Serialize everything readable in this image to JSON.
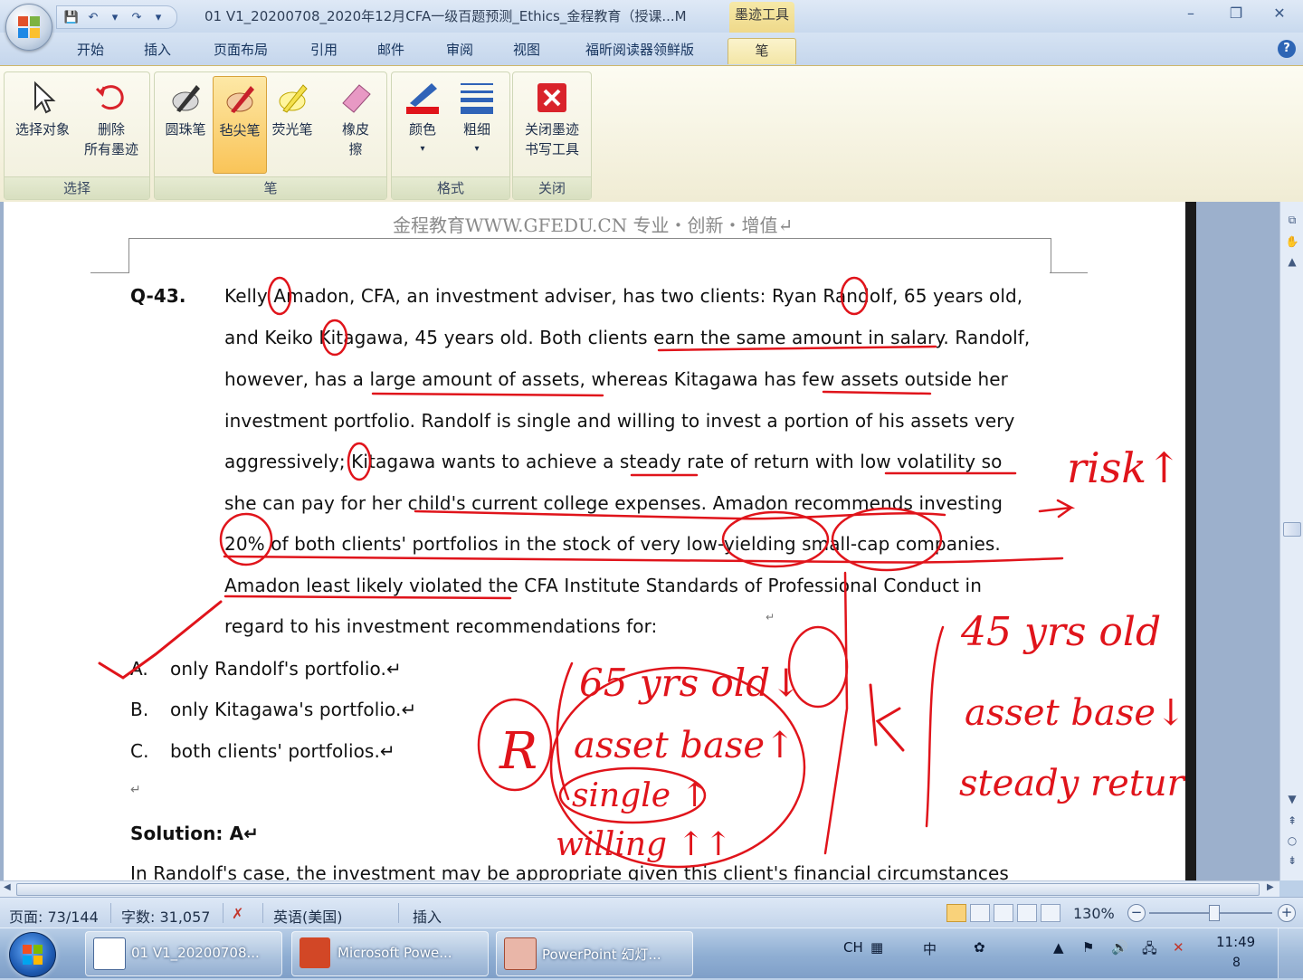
{
  "window": {
    "title": "01 V1_20200708_2020年12月CFA一级百题预测_Ethics_金程教育（授课...M",
    "context_tab": "墨迹工具",
    "minimize": "–",
    "restore": "❐",
    "close": "✕"
  },
  "quick_access": [
    "💾",
    "↶",
    "▾",
    "↷",
    "▾"
  ],
  "tabs": [
    "开始",
    "插入",
    "页面布局",
    "引用",
    "邮件",
    "审阅",
    "视图",
    "福昕阅读器领鲜版",
    "笔"
  ],
  "active_tab": "笔",
  "ribbon": {
    "groups": {
      "select": "选择",
      "pen": "笔",
      "format": "格式",
      "close": "关闭"
    },
    "buttons": {
      "select_objects": "选择对象",
      "delete_all_1": "删除",
      "delete_all_2": "所有墨迹",
      "ballpoint": "圆珠笔",
      "felt_tip": "毡尖笔",
      "highlighter": "荧光笔",
      "eraser_1": "橡皮",
      "eraser_2": "擦",
      "color": "颜色",
      "weight": "粗细",
      "close_ink_1": "关闭墨迹",
      "close_ink_2": "书写工具"
    }
  },
  "document": {
    "header": "金程教育WWW.GFEDU.CN 专业・创新・增值↵",
    "question_id": "Q-43.",
    "lines": [
      "Kelly Amadon, CFA, an investment adviser, has two clients: Ryan Randolf, 65 years old,",
      "and Keiko Kitagawa, 45 years old. Both clients earn the same amount in salary. Randolf,",
      "however, has a large amount of assets, whereas Kitagawa has few assets outside her",
      "investment portfolio. Randolf is single and willing to invest a portion of his assets very",
      "aggressively; Kitagawa wants to achieve a steady rate of return with low volatility so",
      "she can pay for her child's current college expenses. Amadon recommends investing",
      "20% of both clients' portfolios in the stock of very low-yielding small-cap companies.",
      "Amadon least likely violated the CFA Institute Standards of Professional Conduct in",
      "regard to his investment recommendations for:"
    ],
    "paragraph_mark": "↵",
    "options": [
      {
        "letter": "A.",
        "text": "only Randolf's portfolio.↵"
      },
      {
        "letter": "B.",
        "text": "only Kitagawa's portfolio.↵"
      },
      {
        "letter": "C.",
        "text": "both clients' portfolios.↵"
      }
    ],
    "empty_line": "↵",
    "solution": "Solution: A↵",
    "partial_line": "In Randolf's case, the investment may be appropriate given this client's financial circumstances"
  },
  "handwriting": {
    "risk": "risk↑",
    "r_label": "R",
    "r_lines": [
      "65 yrs old↓",
      "asset base↑",
      "single ↑",
      "willing ↑↑"
    ],
    "k_label": "K",
    "k_lines": [
      "45 yrs old",
      "asset base↓",
      "steady return"
    ]
  },
  "status": {
    "page": "页面: 73/144",
    "words": "字数: 31,057",
    "language": "英语(美国)",
    "mode": "插入",
    "zoom": "130%",
    "zoom_minus": "−",
    "zoom_plus": "+"
  },
  "taskbar": {
    "items": [
      "01 V1_20200708...",
      "Microsoft Powe...",
      "PowerPoint 幻灯..."
    ],
    "lang": "CH",
    "ime": "中",
    "time": "11:49",
    "date": "8"
  },
  "colors": {
    "ink": "#e0141b",
    "active_tab": "#f3e6a6",
    "ribbon_active_btn": "#f9c458"
  }
}
